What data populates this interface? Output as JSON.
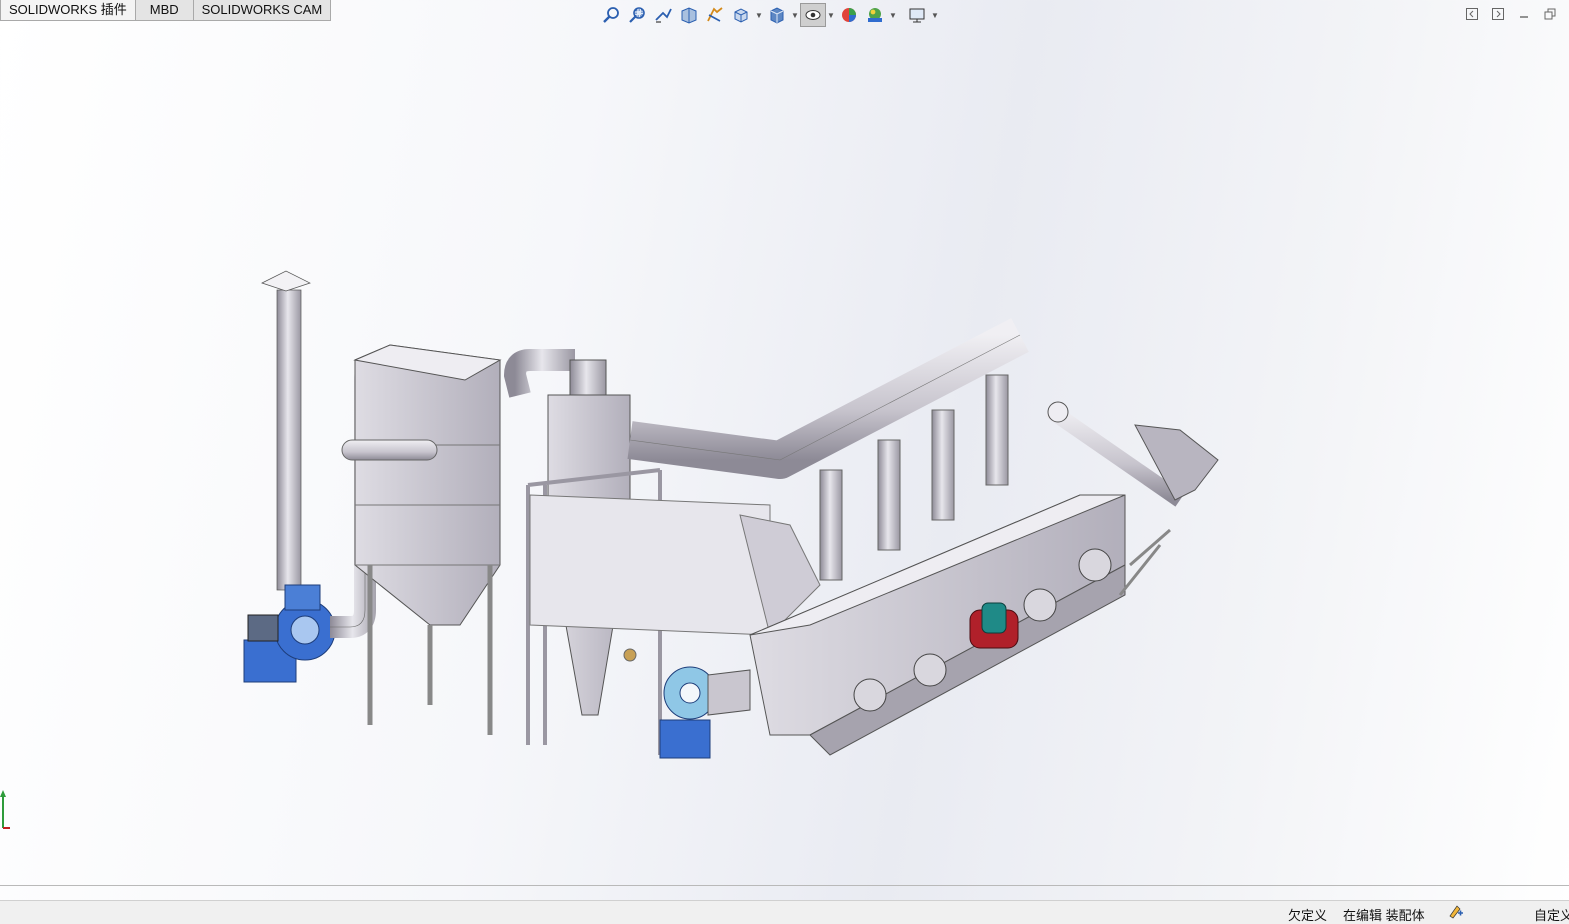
{
  "tabs": [
    {
      "label": "SOLIDWORKS 插件"
    },
    {
      "label": "MBD"
    },
    {
      "label": "SOLIDWORKS CAM"
    }
  ],
  "heads_up_toolbar": {
    "icons": [
      "zoom-to-fit-icon",
      "zoom-to-area-icon",
      "previous-view-icon",
      "section-view-icon",
      "dynamic-annotation-icon",
      "view-orientation-icon",
      "display-style-icon",
      "hide-show-items-icon",
      "edit-appearance-icon",
      "apply-scene-icon",
      "view-settings-icon"
    ]
  },
  "status_bar": {
    "underdefined": "欠定义",
    "editing": "在编辑 装配体",
    "custom": "自定义"
  },
  "colors": {
    "background_light": "#ffffff",
    "background_mid": "#e9ebf2",
    "metal": "#c9c6cf",
    "fan_blue": "#3a6fd0",
    "fan_light_blue": "#8fc7e6",
    "motor_red": "#b0202a",
    "motor_teal": "#1f8a87"
  }
}
